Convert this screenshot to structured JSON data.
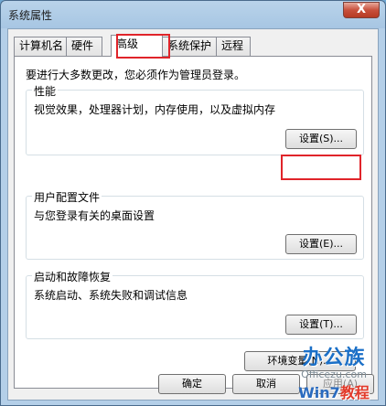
{
  "window": {
    "title": "系统属性",
    "close_glyph": "X"
  },
  "tabs": [
    {
      "label": "计算机名",
      "active": false
    },
    {
      "label": "硬件",
      "active": false
    },
    {
      "label": "高级",
      "active": true
    },
    {
      "label": "系统保护",
      "active": false
    },
    {
      "label": "远程",
      "active": false
    }
  ],
  "notice": "要进行大多数更改，您必须作为管理员登录。",
  "groups": {
    "performance": {
      "title": "性能",
      "description": "视觉效果，处理器计划，内存使用，以及虚拟内存",
      "button": "设置(S)..."
    },
    "user_profiles": {
      "title": "用户配置文件",
      "description": "与您登录有关的桌面设置",
      "button": "设置(E)..."
    },
    "startup_recovery": {
      "title": "启动和故障恢复",
      "description": "系统启动、系统失败和调试信息",
      "button": "设置(T)..."
    }
  },
  "env_button": "环境变量(N)...",
  "footer": {
    "ok": "确定",
    "cancel": "取消",
    "apply": "应用(A)"
  },
  "watermark": {
    "logo": "办公族",
    "site": "Officezu.com",
    "sub_a": "Win7",
    "sub_b": "教程"
  },
  "colors": {
    "highlight_box": "#e0242a",
    "title_bar": "#a7c6e3"
  }
}
